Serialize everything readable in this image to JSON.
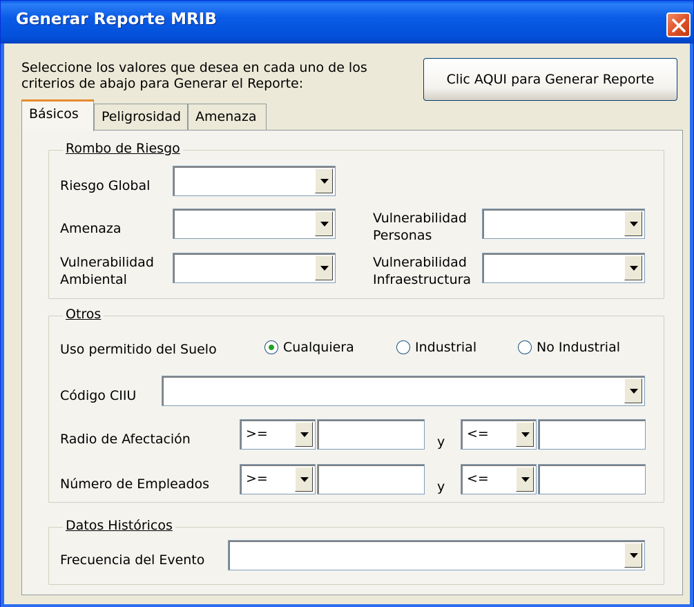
{
  "window": {
    "title": "Generar Reporte MRIB"
  },
  "instructions": "Seleccione los valores que desea en cada uno de los criterios de abajo para Generar el Reporte:",
  "generate_button": "Clic AQUI para Generar Reporte",
  "tabs": [
    {
      "label": "Básicos",
      "active": true
    },
    {
      "label": "Peligrosidad",
      "active": false
    },
    {
      "label": "Amenaza",
      "active": false
    }
  ],
  "rombo": {
    "legend": "Rombo de Riesgo",
    "riesgo_global": "Riesgo Global",
    "amenaza": "Amenaza",
    "vuln_personas_1": "Vulnerabilidad",
    "vuln_personas_2": "Personas",
    "vuln_ambiental_1": "Vulnerabilidad",
    "vuln_ambiental_2": "Ambiental",
    "vuln_infra_1": "Vulnerabilidad",
    "vuln_infra_2": "Infraestructura"
  },
  "otros": {
    "legend": "Otros",
    "uso_suelo": "Uso permitido del Suelo",
    "radio_options": [
      "Cualquiera",
      "Industrial",
      "No Industrial"
    ],
    "selected_option": "Cualquiera",
    "codigo_ciiu": "Código CIIU",
    "radio_afectacion": "Radio de Afectación",
    "num_empleados": "Número de Empleados",
    "op_ge": ">=",
    "op_le": "<=",
    "y": "y"
  },
  "historicos": {
    "legend": "Datos Históricos",
    "frecuencia": "Frecuencia del Evento"
  }
}
